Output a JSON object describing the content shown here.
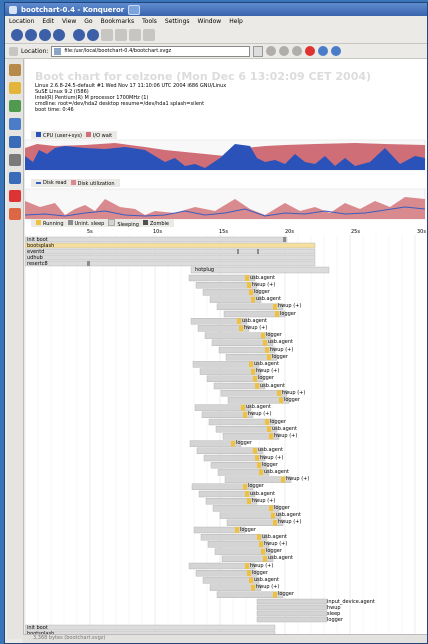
{
  "window": {
    "title": "bootchart-0.4 - Konqueror"
  },
  "menu": [
    "Location",
    "Edit",
    "View",
    "Go",
    "Bookmarks",
    "Tools",
    "Settings",
    "Window",
    "Help"
  ],
  "location": {
    "label": "Location:",
    "url": "file:/usr/local/bootchart-0.4/bootchart.svgz"
  },
  "chart": {
    "title": "Boot chart for celzone (Mon Dec 6 13:02:09 CET 2004)",
    "info": [
      "Linux 2.6.8-24.5-default #1 Wed Nov 17 11:10:06 UTC 2004 i686 GNU/Linux",
      "SuSE Linux 9.2 (i586)",
      "Intel(R) Pentium(R) M processor 1700MHz (1)",
      "cmdline: root=/dev/hda2 desktop resume=/dev/hda1 splash=silent",
      "boot time: 0:46"
    ],
    "cpu_legend": [
      "CPU (user+sys)",
      "I/O wait"
    ],
    "disk_legend": [
      "Disk read",
      "Disk utilization"
    ],
    "proc_legend": [
      "Running",
      "Unint. sleep",
      "Sleeping",
      "Zombie"
    ],
    "axis_ticks": [
      "5s",
      "10s",
      "15s",
      "20s",
      "25s",
      "30s"
    ],
    "colors": {
      "cpu": "#2a52b8",
      "iowait": "#d06e78",
      "running": "#f0c040",
      "unint": "#8c8c8c",
      "sleeping": "#d4d4d4",
      "zombie": "#505050",
      "diskread": "#3a5cc0",
      "diskutil": "#d98a8e"
    },
    "top_processes": [
      "init boot",
      "bootsplash",
      "eventd",
      "udhub",
      "resertc8"
    ],
    "hotplug_label": "hotplug",
    "process_rows": [
      "usb.agent",
      "hwup (+)",
      "logger",
      "usb.agent",
      "hwup (+)",
      "logger",
      "usb.agent",
      "hwup (+)",
      "logger",
      "usb.agent",
      "hwup (+)",
      "logger",
      "usb.agent",
      "hwup (+)",
      "logger",
      "usb.agent",
      "hwup (+)",
      "logger",
      "usb.agent",
      "hwup (+)",
      "logger",
      "usb.agent",
      "hwup (+)",
      "logger",
      "usb.agent",
      "hwup (+)",
      "logger",
      "usb.agent",
      "hwup (+)",
      "logger",
      "usb.agent",
      "hwup (+)",
      "logger",
      "usb.agent",
      "hwup (+)",
      "logger",
      "usb.agent",
      "hwup (+)",
      "logger",
      "usb.agent",
      "hwup (+)",
      "logger",
      "usb.agent",
      "hwup (+)",
      "logger"
    ],
    "late_processes": [
      "input_device.agent",
      "hwup",
      "sleep",
      "logger"
    ],
    "bottom_processes": [
      "init boot",
      "bootsplash"
    ]
  },
  "status": {
    "text": "3,368 bytes  (bootchart.svgz)"
  }
}
